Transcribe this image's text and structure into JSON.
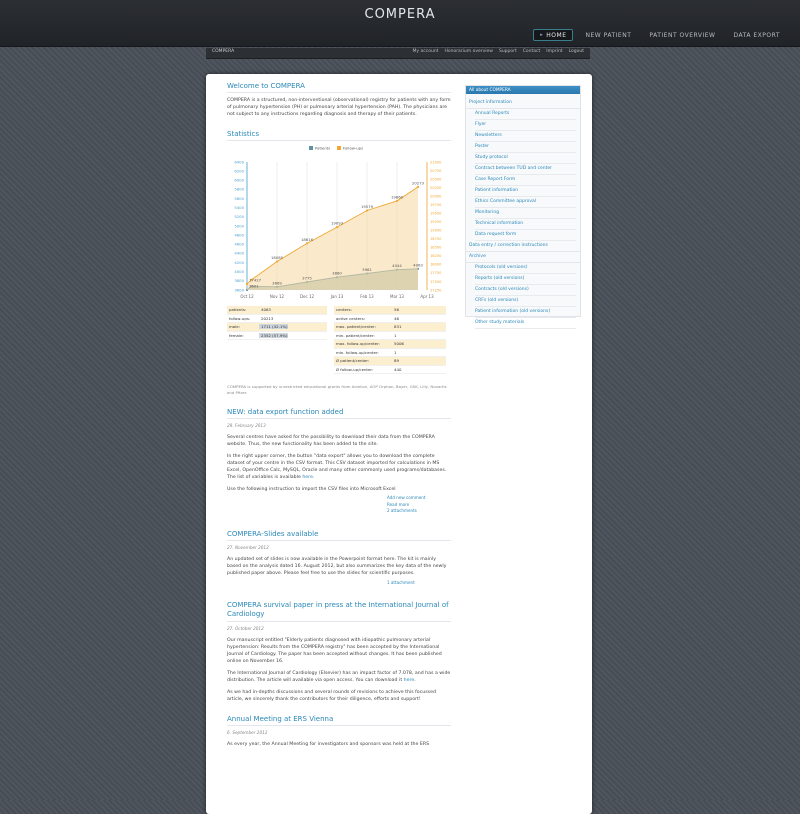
{
  "header": {
    "logo": "COMPERA",
    "nav": [
      {
        "label": "HOME"
      },
      {
        "label": "NEW PATIENT"
      },
      {
        "label": "PATIENT OVERVIEW"
      },
      {
        "label": "DATA EXPORT"
      }
    ]
  },
  "subbar": {
    "brand": "COMPERA",
    "links": [
      {
        "label": "My account"
      },
      {
        "label": "Honorarium overview"
      },
      {
        "label": "Support"
      },
      {
        "label": "Contact"
      },
      {
        "label": "Imprint"
      },
      {
        "label": "Logout"
      }
    ]
  },
  "welcome": {
    "title": "Welcome to COMPERA",
    "text": "COMPERA is a structured, non-interventional (observational) registry for patients with any form of pulmonary hypertension (PH) or pulmonary arterial hypertension (PAH). The physicians are not subject to any instructions regarding diagnosis and therapy of their patients."
  },
  "statistics": {
    "title": "Statistics"
  },
  "chart_data": {
    "type": "line",
    "categories": [
      "Oct 12",
      "Nov 12",
      "Dec 12",
      "Jan 13",
      "Feb 13",
      "Mar 13",
      "Apr 13"
    ],
    "x": [
      0,
      1,
      2,
      3,
      4,
      5,
      6
    ],
    "series": [
      {
        "name": "Patients",
        "color": "#5f93a4",
        "axis": "left",
        "x": [
          0,
          0.15,
          1,
          2,
          3,
          4,
          5,
          5.7
        ],
        "values": [
          3601,
          3681,
          3669,
          3775,
          3880,
          3961,
          4044,
          4063
        ]
      },
      {
        "name": "Follow-ups",
        "color": "#f0a830",
        "axis": "right",
        "x": [
          0,
          0.15,
          1,
          2,
          3,
          4,
          5,
          5.7
        ],
        "values": [
          17427,
          17551,
          18085,
          18616,
          19093,
          19579,
          19860,
          20273
        ]
      }
    ],
    "left_axis": {
      "ticks": [
        3600,
        3800,
        4000,
        4200,
        4400,
        4600,
        4800,
        5000,
        5200,
        5400,
        5600,
        5800,
        6000,
        6200,
        6400
      ]
    },
    "right_axis": {
      "ticks": [
        17250,
        17500,
        17750,
        18000,
        18250,
        18500,
        18750,
        19000,
        19250,
        19500,
        19750,
        20000,
        20250,
        20500,
        20750,
        21000
      ]
    },
    "data_labels": [
      {
        "series": 0,
        "i": 0,
        "text": "3601"
      },
      {
        "series": 0,
        "i": 2,
        "text": "3669"
      },
      {
        "series": 0,
        "i": 3,
        "text": "3775"
      },
      {
        "series": 0,
        "i": 4,
        "text": "3880"
      },
      {
        "series": 0,
        "i": 5,
        "text": "3961"
      },
      {
        "series": 0,
        "i": 6,
        "text": "4044"
      },
      {
        "series": 0,
        "i": 7,
        "text": "4063"
      },
      {
        "series": 1,
        "i": 0,
        "text": "17427"
      },
      {
        "series": 1,
        "i": 2,
        "text": "18085"
      },
      {
        "series": 1,
        "i": 3,
        "text": "18616"
      },
      {
        "series": 1,
        "i": 4,
        "text": "19093"
      },
      {
        "series": 1,
        "i": 5,
        "text": "19579"
      },
      {
        "series": 1,
        "i": 6,
        "text": "19860"
      },
      {
        "series": 1,
        "i": 7,
        "text": "20273"
      }
    ],
    "grid": true,
    "legend": "top"
  },
  "stats_left": [
    {
      "k": "patients:",
      "v": "4063",
      "hl": true
    },
    {
      "k": "follow-ups:",
      "v": "20213",
      "hl": false
    },
    {
      "k": "male:",
      "v": "1711 (42.1%)",
      "hl": true,
      "bar": true
    },
    {
      "k": "female:",
      "v": "2352 (57.9%)",
      "hl": false,
      "bar": true
    }
  ],
  "stats_right": [
    {
      "k": "centers:",
      "v": "56",
      "hl": true
    },
    {
      "k": "active centers:",
      "v": "46",
      "hl": false
    },
    {
      "k": "max. patient/center:",
      "v": "831",
      "hl": true
    },
    {
      "k": "min. patient/center:",
      "v": "1",
      "hl": false
    },
    {
      "k": "max. follow-up/center:",
      "v": "5006",
      "hl": true
    },
    {
      "k": "min. follow-up/center:",
      "v": "1",
      "hl": false
    },
    {
      "k": "Ø patient/center:",
      "v": "89",
      "hl": true
    },
    {
      "k": "Ø follow-up/center:",
      "v": "440",
      "hl": false
    }
  ],
  "support": "COMPERA is supported by unrestricted educational grants from Actelion, AOP Orphan, Bayer, GSK, Lilly, Novartis and Pfizer.",
  "post1": {
    "title": "NEW: data export function added",
    "date": "28. February 2013",
    "p1": "Several centres have asked for the possibility to download their data from the COMPERA website. Thus, the new functionality has been added to the site.",
    "p2a": "In the right upper corner, the button \"data export\" allows you to download the complete dataset of your centre in the CSV format. This CSV dataset imported for calculations in MS Excel, OpenOffice Calc, MySQL, Oracle and many other commonly used programs/databases. The list of variables is available",
    "p2link": "here",
    "p2b": ".",
    "p3": "Use the following instruction to import the CSV files into Microsoft Excel",
    "links": [
      "Add new comment",
      "Read more",
      "2 attachments"
    ]
  },
  "post2": {
    "title": "COMPERA-Slides available",
    "date": "27. November 2012",
    "p1": "An updated set of slides is now available in the Powerpoint format here. The kit is mainly based on the analysis dated 16. August 2012, but also summarizes the key data of the newly published paper above. Please feel free to use the slides for scientific purposes.",
    "links": [
      "1 attachment"
    ]
  },
  "post3": {
    "title": "COMPERA survival paper in press at the International Journal of Cardiology",
    "date": "27. October 2012",
    "p1": "Our manuscript entitled \"Elderly patients diagnosed with idiopathic pulmonary arterial hypertension: Results from the COMPERA registry\" has been accepted by the International Journal of Cardiology. The paper has been accepted without changes. It has been published online on November 16.",
    "p2": "The International Journal of Cardiology (Elsevier) has an impact factor of 7.078, and has a wide distribution. The article will available via open access. You can download it",
    "p2link": "here",
    "p2b": ".",
    "p3": "As we had in-depths discussions and several rounds of revisions to achieve this focussed article, we sincerely thank the contributors for their diligence, efforts and support!"
  },
  "post4": {
    "title": "Annual Meeting at ERS Vienna",
    "date": "6. September 2012",
    "p1": "As every year, the Annual Meeting for investigators and sponsors was held at the ERS"
  },
  "sidebar": {
    "title": "All about COMPERA",
    "sections": [
      {
        "label": "Project information",
        "items": [
          "Annual Reports",
          "Flyer",
          "Newsletters",
          "Poster",
          "Study protocol",
          "Contract between TUD and center",
          "Case Report Form",
          "Patient information",
          "Ethics Committee approval",
          "Monitoring",
          "Technical information",
          "Data request form"
        ]
      },
      {
        "label": "Data entry / correction instructions",
        "items": []
      },
      {
        "label": "Archive",
        "items": [
          "Protocols (old versions)",
          "Reports (old versions)",
          "Contracts (old versions)",
          "CRFs (old versions)",
          "Patient information (old versions)",
          "Other study materials"
        ]
      }
    ]
  }
}
